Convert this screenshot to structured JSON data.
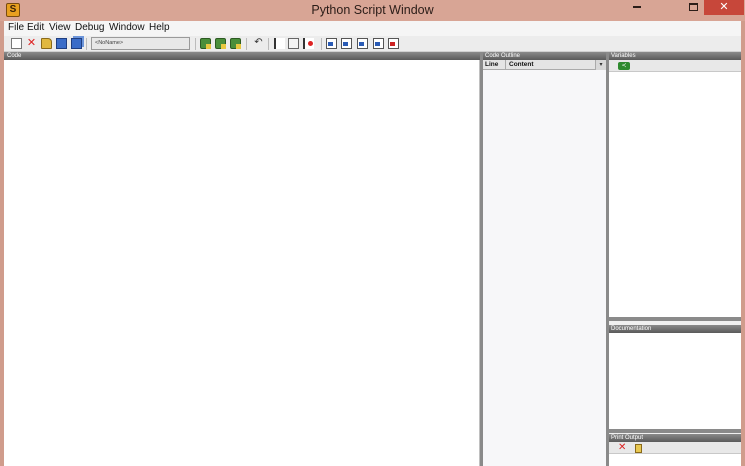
{
  "window": {
    "title": "Python Script Window",
    "app_icon": "python-script-app-icon",
    "app_icon_glyph": "S",
    "controls": {
      "minimize": "minimize-icon",
      "maximize": "maximize-icon",
      "close": "✕"
    }
  },
  "menu": {
    "items": [
      "File",
      "Edit",
      "View",
      "Debug",
      "Window",
      "Help"
    ]
  },
  "toolbar": {
    "icons": [
      "new-file-icon",
      "close-file-icon",
      "open-folder-icon",
      "save-icon",
      "save-all-icon",
      "run-script-icon",
      "run-selection-icon",
      "run-debug-icon",
      "undo-icon",
      "toggle-breakpoint-icon",
      "step-icon",
      "stop-icon",
      "indent-icon",
      "outdent-icon",
      "comment-icon",
      "uncomment-icon",
      "clear-marks-icon"
    ],
    "script_name": "<NoName>",
    "close_glyph": "✕",
    "undo_glyph": "↶"
  },
  "panels": {
    "code": {
      "title": "Code"
    },
    "outline": {
      "title": "Code Outline",
      "columns": [
        "Line",
        "Content"
      ],
      "dropdown_glyph": "▾"
    },
    "variables": {
      "title": "Variables",
      "tool_glyph": "≺"
    },
    "documentation": {
      "title": "Documentation"
    },
    "print_output": {
      "title": "Print Output",
      "clear_glyph": "✕"
    }
  },
  "colors": {
    "titlebar": "#d8a595",
    "close_button": "#c7473a",
    "panel_header": "#6a6a6a",
    "frame": "#f0f0f0"
  }
}
